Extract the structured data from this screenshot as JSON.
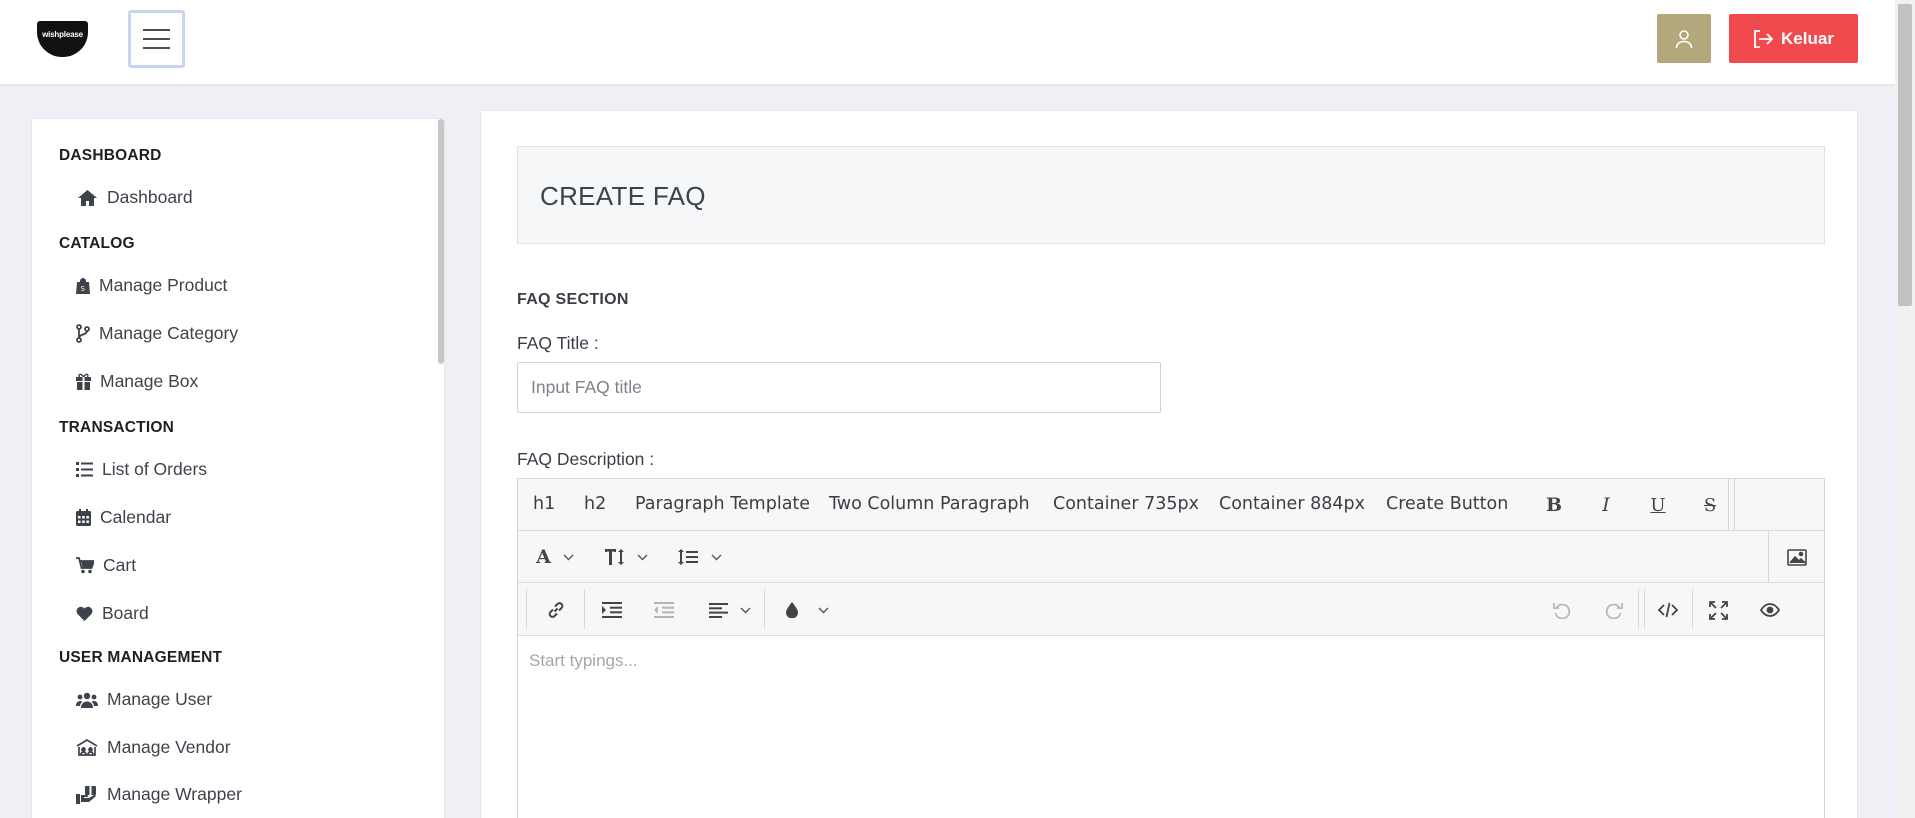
{
  "header": {
    "logo_text": "wishplease",
    "logout_label": "Keluar"
  },
  "sidebar": {
    "sections": [
      {
        "title": "DASHBOARD",
        "items": [
          {
            "label": "Dashboard",
            "icon": "home-icon"
          }
        ]
      },
      {
        "title": "CATALOG",
        "items": [
          {
            "label": "Manage Product",
            "icon": "shopping-bag-icon"
          },
          {
            "label": "Manage Category",
            "icon": "code-branch-icon"
          },
          {
            "label": "Manage Box",
            "icon": "gift-box-icon"
          }
        ]
      },
      {
        "title": "TRANSACTION",
        "items": [
          {
            "label": "List of Orders",
            "icon": "list-icon"
          },
          {
            "label": "Calendar",
            "icon": "calendar-icon"
          },
          {
            "label": "Cart",
            "icon": "cart-icon"
          },
          {
            "label": "Board",
            "icon": "heart-icon"
          }
        ]
      },
      {
        "title": "USER MANAGEMENT",
        "items": [
          {
            "label": "Manage User",
            "icon": "users-icon"
          },
          {
            "label": "Manage Vendor",
            "icon": "vendor-icon"
          },
          {
            "label": "Manage Wrapper",
            "icon": "wrapper-icon"
          }
        ]
      }
    ]
  },
  "main": {
    "page_title": "CREATE FAQ",
    "section_label": "FAQ SECTION",
    "faq_title_label": "FAQ Title :",
    "faq_title_value": "",
    "faq_title_placeholder": "Input FAQ title",
    "faq_description_label": "FAQ Description :",
    "editor": {
      "toolbar_templates": [
        "h1",
        "h2",
        "Paragraph Template",
        "Two Column Paragraph",
        "Container 735px",
        "Container 884px",
        "Create Button"
      ],
      "format_buttons": [
        "bold-icon",
        "italic-icon",
        "underline-icon",
        "strikethrough-icon"
      ],
      "placeholder": "Start typings..."
    }
  },
  "colors": {
    "user_button": "#b3a77c",
    "logout_button": "#f04a4e",
    "hamburger_border": "#c9d3ee"
  }
}
